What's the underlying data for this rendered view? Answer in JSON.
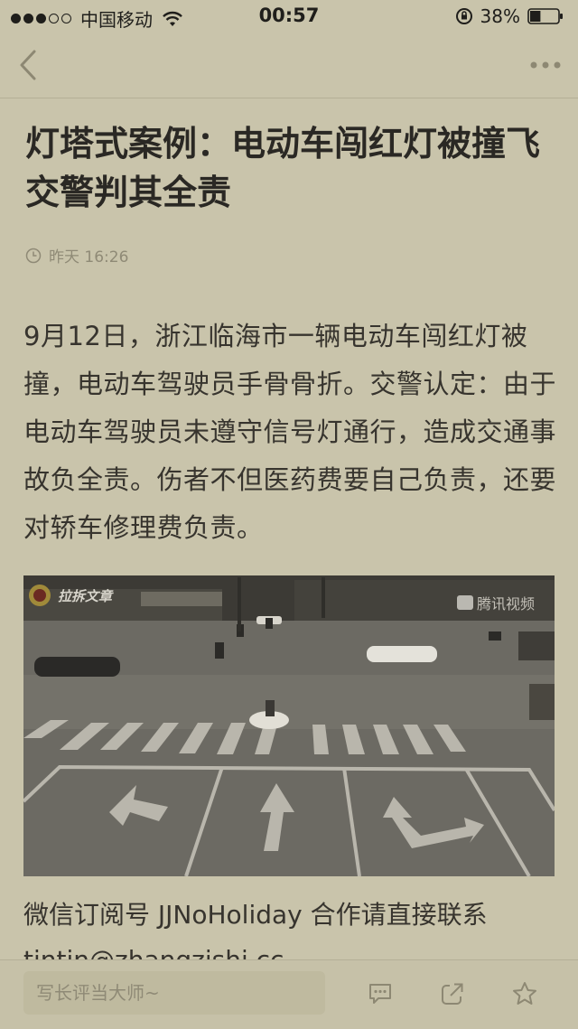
{
  "status_bar": {
    "carrier": "中国移动",
    "time": "00:57",
    "battery": "38%",
    "battery_level": 0.38,
    "signal_bars_filled": 3,
    "signal_bars_total": 5
  },
  "nav": {
    "back_icon": "chevron-left-icon",
    "more_icon": "more-dots-icon"
  },
  "article": {
    "title": "灯塔式案例：电动车闯红灯被撞飞交警判其全责",
    "time": "昨天 16:26",
    "body": "9月12日，浙江临海市一辆电动车闯红灯被撞，电动车驾驶员手骨骨折。交警认定：由于电动车驾驶员未遵守信号灯通行，造成交通事故负全责。伤者不但医药费要自己负责，还要对轿车修理费负责。",
    "photo_watermark_left": "拉拆文章",
    "photo_watermark_right": "腾讯视频",
    "caption": "微信订阅号 JJNoHoliday 合作请直接联系",
    "partial_line": "tintin@zhangzishi.cc"
  },
  "toolbar": {
    "comment_placeholder": "写长评当大师~",
    "comments_icon": "comment-icon",
    "share_icon": "share-icon",
    "favorite_icon": "star-icon"
  },
  "colors": {
    "background": "#c9c4ab",
    "text": "#2a2824",
    "muted": "#8f8a76"
  }
}
